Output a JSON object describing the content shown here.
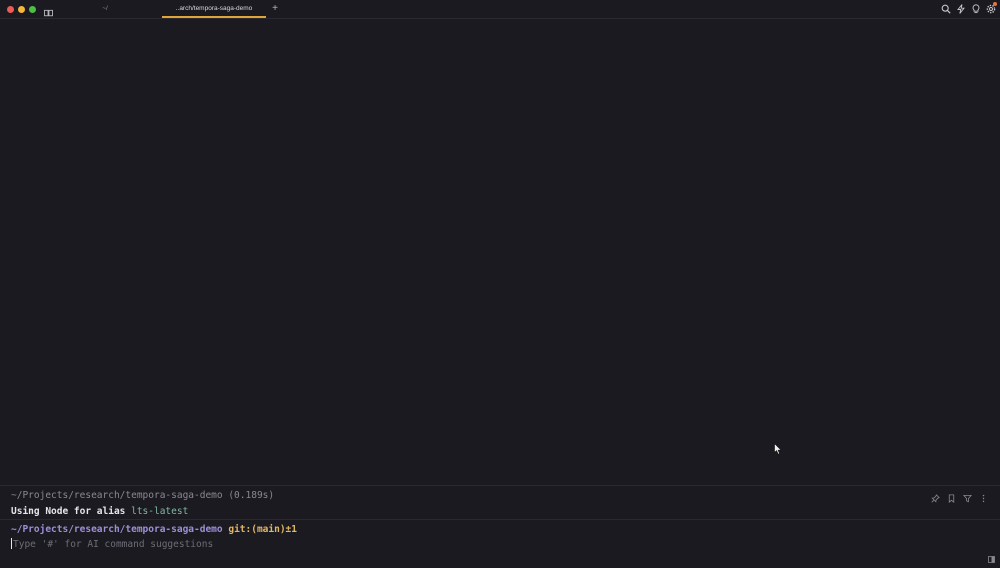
{
  "tabs": [
    {
      "label": "~/"
    },
    {
      "label": "..arch/tempora-saga-demo",
      "active": true
    }
  ],
  "colors": {
    "accent": "#e0a53a",
    "prompt_path": "#9e8fd6",
    "git_branch": "#e3b764",
    "alias": "#7fb8a4"
  },
  "block": {
    "command": "~/Projects/research/tempora-saga-demo (0.189s)",
    "output_prefix": "Using Node for alias ",
    "output_alias": "lts-latest"
  },
  "prompt": {
    "path": "~/Projects/research/tempora-saga-demo",
    "git": "git:(main)±1"
  },
  "input": {
    "placeholder": "Type '#' for AI command suggestions"
  }
}
